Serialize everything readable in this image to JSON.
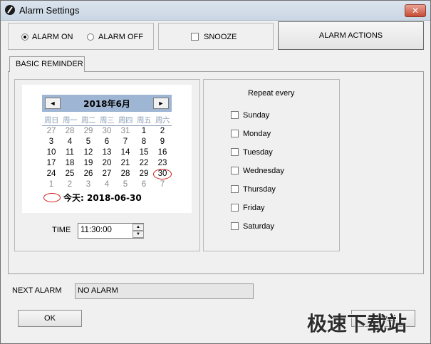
{
  "window": {
    "title": "Alarm Settings",
    "close_symbol": "✕"
  },
  "alarm": {
    "on_label": "ALARM ON",
    "off_label": "ALARM OFF",
    "state": "on",
    "snooze_label": "SNOOZE",
    "snooze_checked": false,
    "actions_label": "ALARM ACTIONS"
  },
  "tabs": [
    {
      "label": "BASIC REMINDER",
      "active": true
    }
  ],
  "calendar": {
    "title": "2018年6月",
    "prev_symbol": "◄",
    "next_symbol": "►",
    "weekdays": [
      "周日",
      "周一",
      "周二",
      "周三",
      "周四",
      "周五",
      "周六"
    ],
    "weeks": [
      [
        "27",
        "28",
        "29",
        "30",
        "31",
        "1",
        "2"
      ],
      [
        "3",
        "4",
        "5",
        "6",
        "7",
        "8",
        "9"
      ],
      [
        "10",
        "11",
        "12",
        "13",
        "14",
        "15",
        "16"
      ],
      [
        "17",
        "18",
        "19",
        "20",
        "21",
        "22",
        "23"
      ],
      [
        "24",
        "25",
        "26",
        "27",
        "28",
        "29",
        "30"
      ],
      [
        "1",
        "2",
        "3",
        "4",
        "5",
        "6",
        "7"
      ]
    ],
    "muted_first_row_count": 5,
    "muted_last_row": true,
    "selected_day": "30",
    "today_label": "今天: 2018-06-30",
    "ring_color": "#d01a1a",
    "header_color": "#9eb6d4"
  },
  "time": {
    "label": "TIME",
    "value": "11:30:00",
    "up_symbol": "▲",
    "down_symbol": "▼"
  },
  "repeat": {
    "title": "Repeat every",
    "days": [
      {
        "label": "Sunday",
        "checked": false
      },
      {
        "label": "Monday",
        "checked": false
      },
      {
        "label": "Tuesday",
        "checked": false
      },
      {
        "label": "Wednesday",
        "checked": false
      },
      {
        "label": "Thursday",
        "checked": false
      },
      {
        "label": "Friday",
        "checked": false
      },
      {
        "label": "Saturday",
        "checked": false
      }
    ]
  },
  "next_alarm": {
    "label": "NEXT ALARM",
    "value": "NO ALARM"
  },
  "buttons": {
    "ok_label": "OK",
    "cancel_label": "Cancel"
  },
  "watermark": "极速下载站"
}
